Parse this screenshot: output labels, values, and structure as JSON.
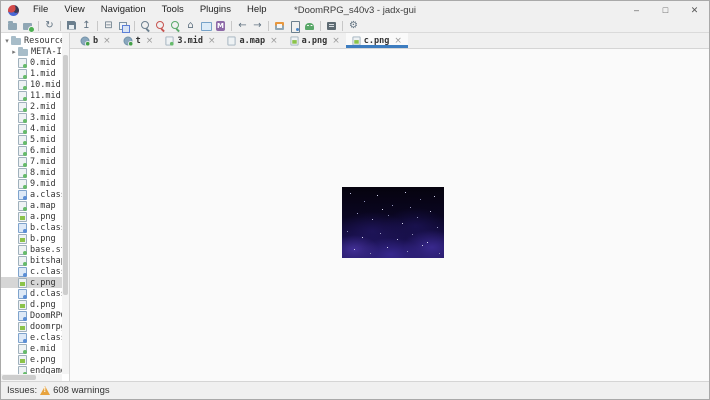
{
  "window": {
    "title": "*DoomRPG_s40v3 - jadx-gui",
    "menus": [
      "File",
      "View",
      "Navigation",
      "Tools",
      "Plugins",
      "Help"
    ],
    "controls": [
      {
        "name": "minimize",
        "glyph": "–"
      },
      {
        "name": "maximize",
        "glyph": "□"
      },
      {
        "name": "close",
        "glyph": "✕"
      }
    ]
  },
  "toolbar": {
    "groups": [
      {
        "icons": [
          {
            "name": "open-file",
            "title": "Open file"
          },
          {
            "name": "add-files",
            "title": "Add files"
          }
        ]
      },
      {
        "icons": [
          {
            "name": "reload",
            "title": "Reload files",
            "glyph": "↻"
          }
        ]
      },
      {
        "icons": [
          {
            "name": "save-all",
            "title": "Save all"
          },
          {
            "name": "export",
            "title": "Export",
            "glyph": "↥"
          }
        ]
      },
      {
        "icons": [
          {
            "name": "flat-packages",
            "title": "Flatten packages",
            "glyph": "⊟"
          },
          {
            "name": "sync",
            "title": "Sync with editor"
          }
        ]
      },
      {
        "icons": [
          {
            "name": "text-search",
            "title": "Text search"
          },
          {
            "name": "class-search",
            "title": "Class search"
          },
          {
            "name": "comment-search",
            "title": "Comment search"
          },
          {
            "name": "main-activity",
            "title": "Main activity",
            "glyph": "⌂"
          },
          {
            "name": "comments",
            "title": "Comments"
          },
          {
            "name": "methods",
            "title": "Methods"
          }
        ]
      },
      {
        "icons": [
          {
            "name": "back",
            "title": "Back",
            "glyph": "←"
          },
          {
            "name": "forward",
            "title": "Forward",
            "glyph": "→"
          }
        ]
      },
      {
        "icons": [
          {
            "name": "deobfuscation",
            "title": "Deobfuscation"
          },
          {
            "name": "device",
            "title": "Quark analysis"
          },
          {
            "name": "android",
            "title": "ADB debugger"
          }
        ]
      },
      {
        "icons": [
          {
            "name": "log-viewer",
            "title": "Log viewer"
          }
        ]
      },
      {
        "icons": [
          {
            "name": "preferences",
            "title": "Preferences",
            "glyph": "⚙"
          }
        ]
      }
    ]
  },
  "tabs": {
    "close_glyph": "×",
    "items": [
      {
        "label": "b",
        "icon": "class",
        "active": false
      },
      {
        "label": "t",
        "icon": "class",
        "active": false
      },
      {
        "label": "3.mid",
        "icon": "audio",
        "active": false
      },
      {
        "label": "a.map",
        "icon": "doc",
        "active": false
      },
      {
        "label": "a.png",
        "icon": "image",
        "active": false
      },
      {
        "label": "c.png",
        "icon": "image",
        "active": true
      }
    ]
  },
  "tree": {
    "items": [
      {
        "label": "Resources",
        "type": "folder",
        "level": 0,
        "expanded": true
      },
      {
        "label": "META-INF",
        "type": "folder",
        "level": 1,
        "expanded": false
      },
      {
        "label": "0.mid",
        "type": "audio",
        "level": 1
      },
      {
        "label": "1.mid",
        "type": "audio",
        "level": 1
      },
      {
        "label": "10.mid",
        "type": "audio",
        "level": 1
      },
      {
        "label": "11.mid",
        "type": "audio",
        "level": 1
      },
      {
        "label": "2.mid",
        "type": "audio",
        "level": 1
      },
      {
        "label": "3.mid",
        "type": "audio",
        "level": 1
      },
      {
        "label": "4.mid",
        "type": "audio",
        "level": 1
      },
      {
        "label": "5.mid",
        "type": "audio",
        "level": 1
      },
      {
        "label": "6.mid",
        "type": "audio",
        "level": 1
      },
      {
        "label": "7.mid",
        "type": "audio",
        "level": 1
      },
      {
        "label": "8.mid",
        "type": "audio",
        "level": 1
      },
      {
        "label": "9.mid",
        "type": "audio",
        "level": 1
      },
      {
        "label": "a.class",
        "type": "classfile",
        "level": 1
      },
      {
        "label": "a.map",
        "type": "audio",
        "level": 1
      },
      {
        "label": "a.png",
        "type": "image",
        "level": 1
      },
      {
        "label": "b.class",
        "type": "classfile",
        "level": 1
      },
      {
        "label": "b.png",
        "type": "image",
        "level": 1
      },
      {
        "label": "base.str",
        "type": "audio",
        "level": 1
      },
      {
        "label": "bitshape",
        "type": "audio",
        "level": 1
      },
      {
        "label": "c.class",
        "type": "classfile",
        "level": 1
      },
      {
        "label": "c.png",
        "type": "image",
        "level": 1,
        "selected": true
      },
      {
        "label": "d.class",
        "type": "classfile",
        "level": 1
      },
      {
        "label": "d.png",
        "type": "image",
        "level": 1
      },
      {
        "label": "DoomRPG",
        "type": "classfile",
        "level": 1
      },
      {
        "label": "doomrpg",
        "type": "image",
        "level": 1
      },
      {
        "label": "e.class",
        "type": "classfile",
        "level": 1
      },
      {
        "label": "e.mid",
        "type": "audio",
        "level": 1
      },
      {
        "label": "e.png",
        "type": "image",
        "level": 1
      },
      {
        "label": "endgame",
        "type": "audio",
        "level": 1
      }
    ]
  },
  "statusbar": {
    "issues_label": "Issues:",
    "warnings_text": "608 warnings"
  },
  "colors": {
    "active_tab_underline": "#3d7dc0",
    "warning_triangle": "#e8a33d",
    "tree_selection": "#d6d6d6",
    "window_chrome": "#f0f0f0"
  }
}
